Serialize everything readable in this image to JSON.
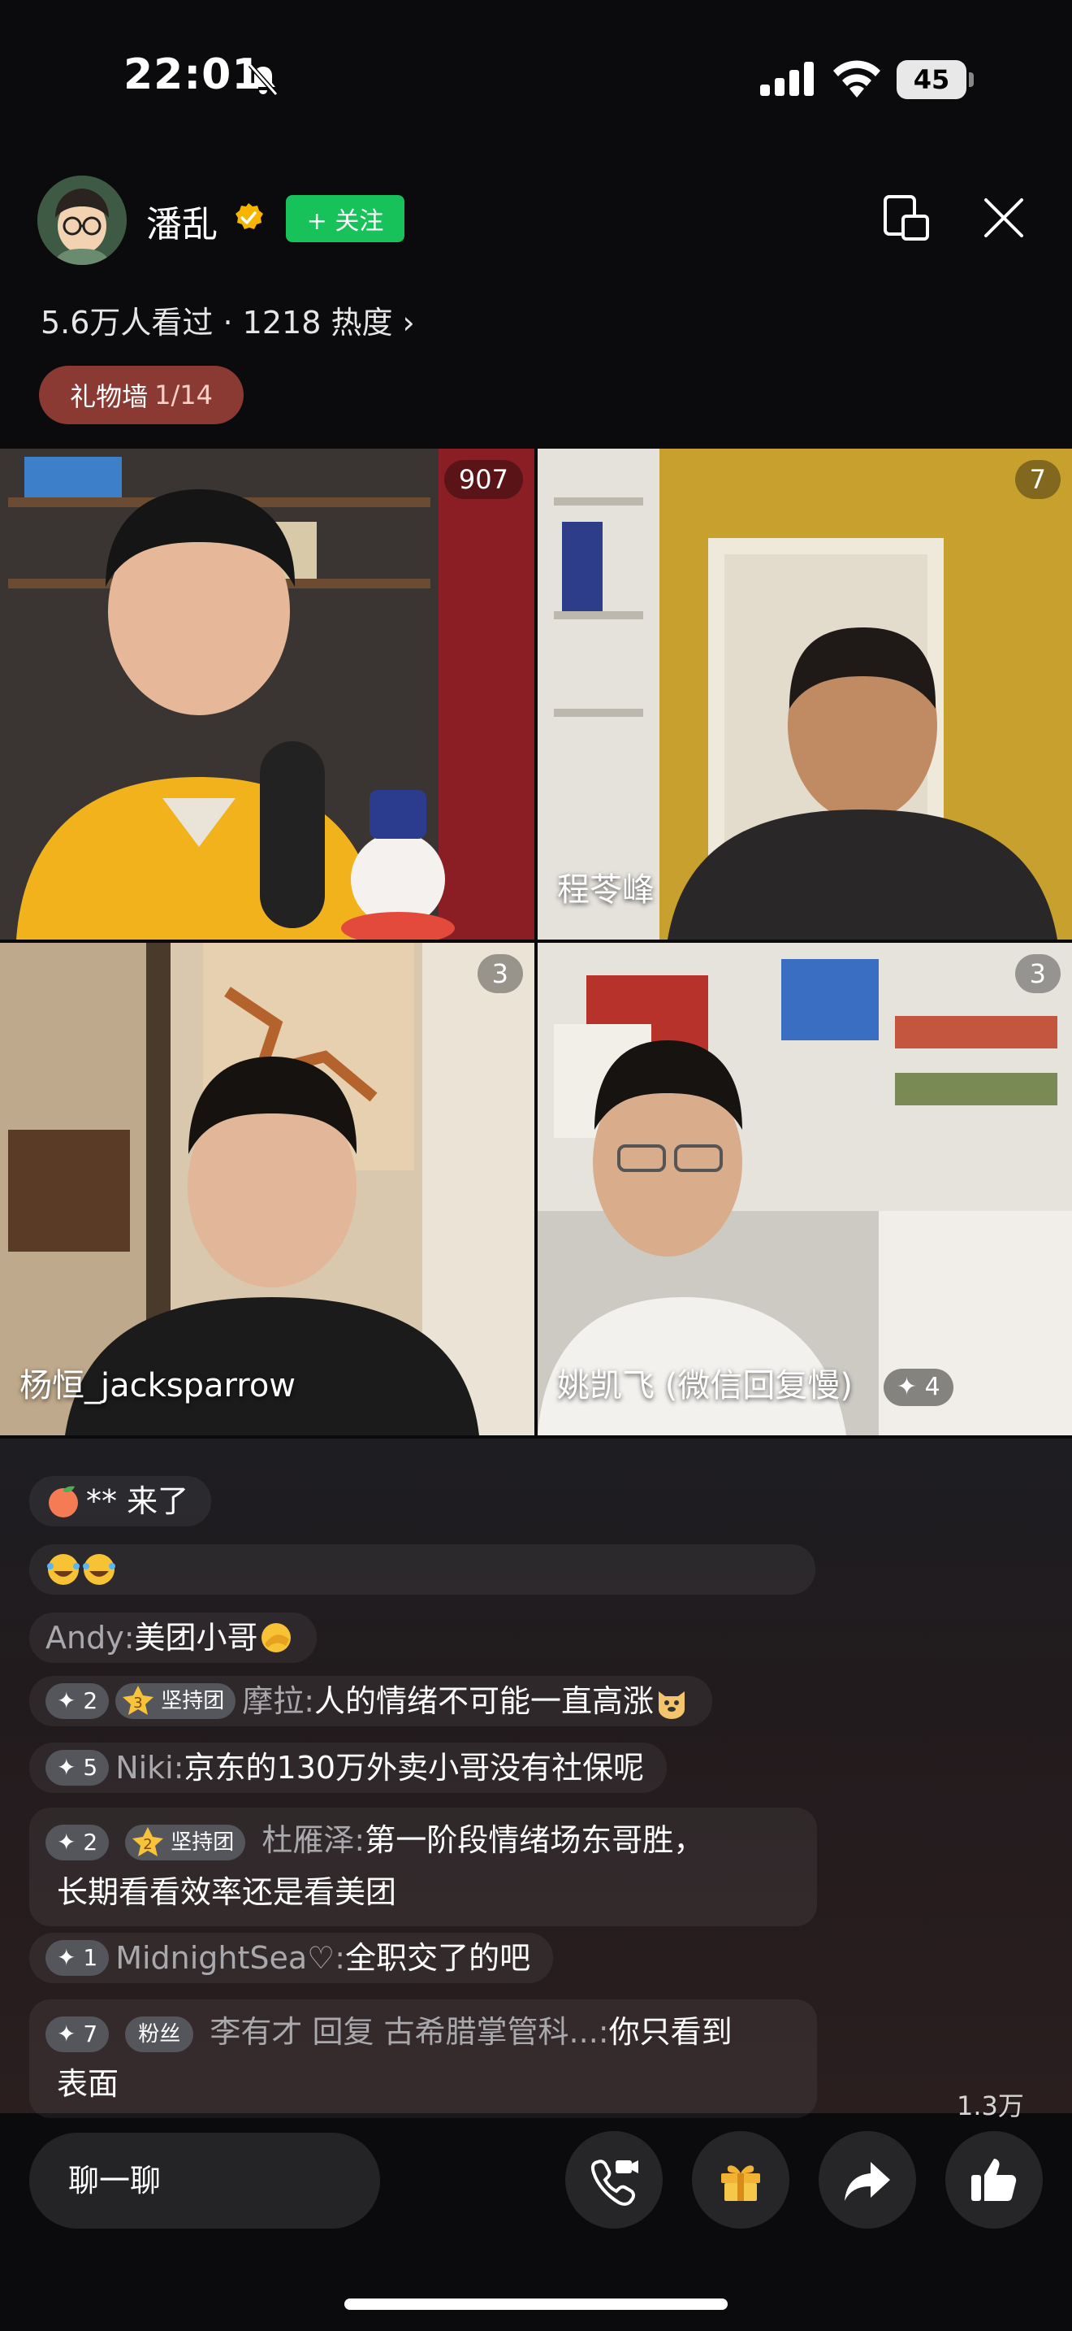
{
  "status_bar": {
    "time": "22:01",
    "battery": "45",
    "icons": [
      "mute-icon",
      "signal-icon",
      "wifi-icon",
      "battery-icon"
    ]
  },
  "header": {
    "streamer_name": "潘乱",
    "follow_label": "+ 关注",
    "viewer_stats": "5.6万人看过 · 1218 热度 ›",
    "gift_wall_label": "礼物墙",
    "gift_wall_count": "1/14",
    "icons": [
      "verified-icon",
      "pip-icon",
      "close-icon"
    ]
  },
  "video_grid": {
    "tiles": [
      {
        "name": "",
        "count": "907"
      },
      {
        "name": "程苓峰",
        "count": "7"
      },
      {
        "name": "杨恒_jacksparrow",
        "count": "3"
      },
      {
        "name": "姚凯飞 (微信回复慢)",
        "count": "3",
        "guest_badge": "✦ 4"
      }
    ]
  },
  "chat": {
    "messages": [
      {
        "user": "",
        "text": "** 来了",
        "emoji": "peach-emoji"
      },
      {
        "user": "",
        "text": "",
        "emoji": "laughing-emoji x2"
      },
      {
        "user": "Andy",
        "text": "美团小哥",
        "emoji": "facepalm-emoji"
      },
      {
        "level": "✦ 2",
        "fan_badge": "坚持团",
        "fan_level": "3",
        "user": "摩拉",
        "text": "人的情绪不可能一直高涨",
        "emoji": "doge-emoji"
      },
      {
        "level": "✦ 5",
        "user": "Niki",
        "text": "京东的130万外卖小哥没有社保呢"
      },
      {
        "level": "✦ 2",
        "fan_badge": "坚持团",
        "fan_level": "2",
        "user": "杜雁泽",
        "text": "第一阶段情绪场东哥胜，",
        "text2": "长期看看效率还是看美团"
      },
      {
        "level": "✦ 1",
        "user": "MidnightSea♡",
        "text": "全职交了的吧"
      },
      {
        "level": "✦ 7",
        "fan_badge": "粉丝",
        "user": "李有才 回复 古希腊掌管科...",
        "text": "你只看到",
        "text2": "表面"
      }
    ]
  },
  "bottom_bar": {
    "chat_placeholder": "聊一聊",
    "like_count": "1.3万",
    "icons": [
      "video-call-icon",
      "gift-icon",
      "share-icon",
      "like-icon"
    ]
  }
}
